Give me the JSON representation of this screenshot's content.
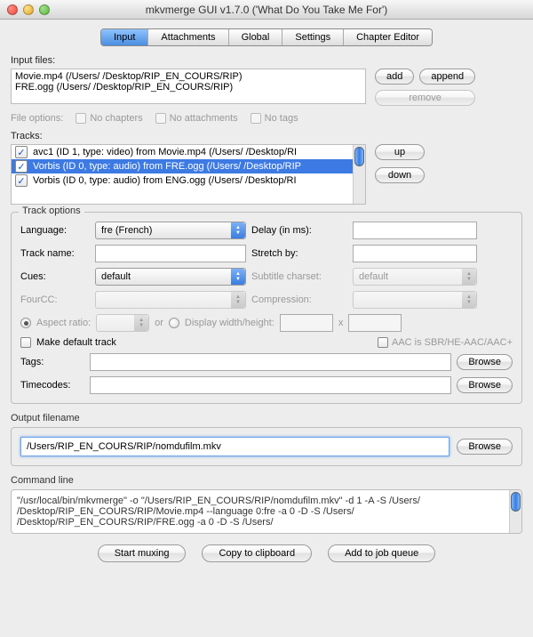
{
  "window": {
    "title": "mkvmerge GUI v1.7.0 ('What Do You Take Me For')"
  },
  "tabs": {
    "input": "Input",
    "attachments": "Attachments",
    "global": "Global",
    "settings": "Settings",
    "chapter": "Chapter Editor"
  },
  "input_files": {
    "label": "Input files:",
    "items": [
      "Movie.mp4 (/Users/            /Desktop/RIP_EN_COURS/RIP)",
      "FRE.ogg (/Users/            /Desktop/RIP_EN_COURS/RIP)"
    ],
    "add": "add",
    "append": "append",
    "remove": "remove"
  },
  "file_options": {
    "label": "File options:",
    "no_chapters": "No chapters",
    "no_attachments": "No attachments",
    "no_tags": "No tags"
  },
  "tracks": {
    "label": "Tracks:",
    "items": [
      "avc1 (ID 1, type: video) from Movie.mp4 (/Users/            /Desktop/RI",
      "Vorbis (ID 0, type: audio) from FRE.ogg (/Users/            /Desktop/RIP",
      "Vorbis (ID 0, type: audio) from ENG.ogg (/Users/            /Desktop/RI"
    ],
    "up": "up",
    "down": "down"
  },
  "track_options": {
    "legend": "Track options",
    "language": {
      "label": "Language:",
      "value": "fre (French)"
    },
    "track_name": {
      "label": "Track name:",
      "value": ""
    },
    "cues": {
      "label": "Cues:",
      "value": "default"
    },
    "fourcc": {
      "label": "FourCC:",
      "value": ""
    },
    "delay": {
      "label": "Delay (in ms):",
      "value": ""
    },
    "stretch": {
      "label": "Stretch by:",
      "value": ""
    },
    "subtitle_charset": {
      "label": "Subtitle charset:",
      "value": "default"
    },
    "compression": {
      "label": "Compression:",
      "value": ""
    },
    "aspect": {
      "label": "Aspect ratio:",
      "or": "or",
      "dwh": "Display width/height:",
      "x": "x"
    },
    "make_default": "Make default track",
    "aac_sbr": "AAC is SBR/HE-AAC/AAC+",
    "tags": {
      "label": "Tags:",
      "browse": "Browse"
    },
    "timecodes": {
      "label": "Timecodes:",
      "browse": "Browse"
    }
  },
  "output": {
    "label": "Output filename",
    "value": "/Users/RIP_EN_COURS/RIP/nomdufilm.mkv",
    "browse": "Browse"
  },
  "command_line": {
    "label": "Command line",
    "value": "\"/usr/local/bin/mkvmerge\" -o \"/Users/RIP_EN_COURS/RIP/nomdufilm.mkv\"  -d 1 -A -S /Users/            /Desktop/RIP_EN_COURS/RIP/Movie.mp4 --language 0:fre -a 0 -D -S /Users/            /Desktop/RIP_EN_COURS/RIP/FRE.ogg -a 0 -D -S /Users/"
  },
  "buttons": {
    "start": "Start muxing",
    "copy": "Copy to clipboard",
    "queue": "Add to job queue"
  }
}
